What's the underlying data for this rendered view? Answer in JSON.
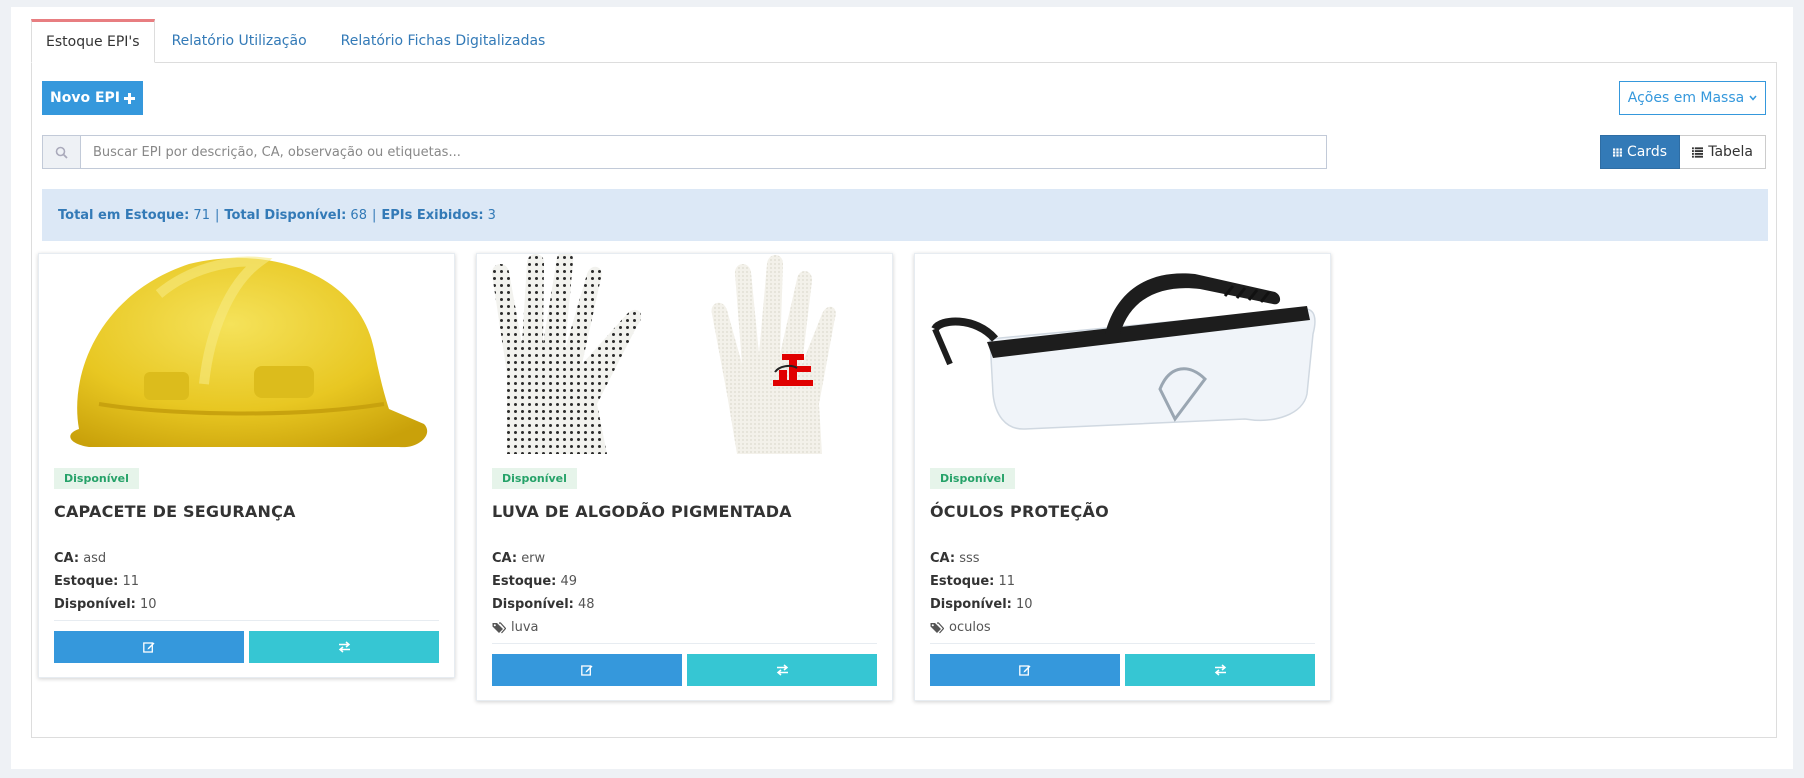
{
  "tabs": [
    {
      "label": "Estoque EPI's",
      "active": true
    },
    {
      "label": "Relatório Utilização",
      "active": false
    },
    {
      "label": "Relatório Fichas Digitalizadas",
      "active": false
    }
  ],
  "toolbar": {
    "new_button": "Novo EPI",
    "new_icon": "plus-icon",
    "bulk_button": "Ações em Massa",
    "bulk_icon": "chevron-down-icon"
  },
  "search": {
    "placeholder": "Buscar EPI por descrição, CA, observação ou etiquetas...",
    "value": ""
  },
  "view_toggle": {
    "cards_label": "Cards",
    "table_label": "Tabela",
    "active": "cards"
  },
  "summary": {
    "total_stock_label": "Total em Estoque:",
    "total_stock": "71",
    "total_available_label": "Total Disponível:",
    "total_available": "68",
    "shown_label": "EPIs Exibidos:",
    "shown": "3",
    "separator": "|"
  },
  "cards": [
    {
      "image": "yellow-hard-hat",
      "status": "Disponível",
      "title": "CAPACETE DE SEGURANÇA",
      "ca_label": "CA:",
      "ca": "asd",
      "stock_label": "Estoque:",
      "stock": "11",
      "available_label": "Disponível:",
      "available": "10",
      "tags": ""
    },
    {
      "image": "dotted-cotton-gloves",
      "status": "Disponível",
      "title": "LUVA DE ALGODÃO PIGMENTADA",
      "ca_label": "CA:",
      "ca": "erw",
      "stock_label": "Estoque:",
      "stock": "49",
      "available_label": "Disponível:",
      "available": "48",
      "tags": "luva"
    },
    {
      "image": "safety-glasses",
      "status": "Disponível",
      "title": "ÓCULOS PROTEÇÃO",
      "ca_label": "CA:",
      "ca": "sss",
      "stock_label": "Estoque:",
      "stock": "11",
      "available_label": "Disponível:",
      "available": "10",
      "tags": "oculos"
    }
  ],
  "colors": {
    "primary": "#3598dc",
    "info": "#36c6d3",
    "active_tab_border": "#e87e81",
    "summary_bg": "#dce8f6",
    "badge_bg": "#e6f4ea",
    "badge_text": "#26a269"
  }
}
